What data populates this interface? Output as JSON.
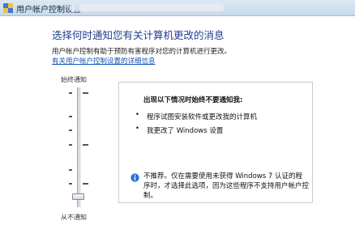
{
  "window": {
    "title": "用户帐户控制设置"
  },
  "main": {
    "heading": "选择何时通知您有关计算机更改的消息",
    "description": "用户帐户控制有助于预防有害程序对您的计算机进行更改。",
    "link": "有关用户帐户控制设置的详细信息"
  },
  "slider": {
    "top_label": "始终通知",
    "bottom_label": "从不通知",
    "selected_level": 1,
    "levels_total": 4
  },
  "panel": {
    "title": "出现以下情况时始终不要通知我:",
    "bullets": [
      "程序试图安装软件或更改我的计算机",
      "我更改了 Windows 设置"
    ],
    "note": "不推荐。仅在需要使用未获得 Windows 7 认证的程序时，才选择此选项，因为这些程序不支持用户帐户控制。"
  },
  "colors": {
    "heading": "#1f3f8f",
    "link": "#1a55b8",
    "titlebar": "#c7d9ea",
    "info_icon": "#2a6fd6"
  }
}
